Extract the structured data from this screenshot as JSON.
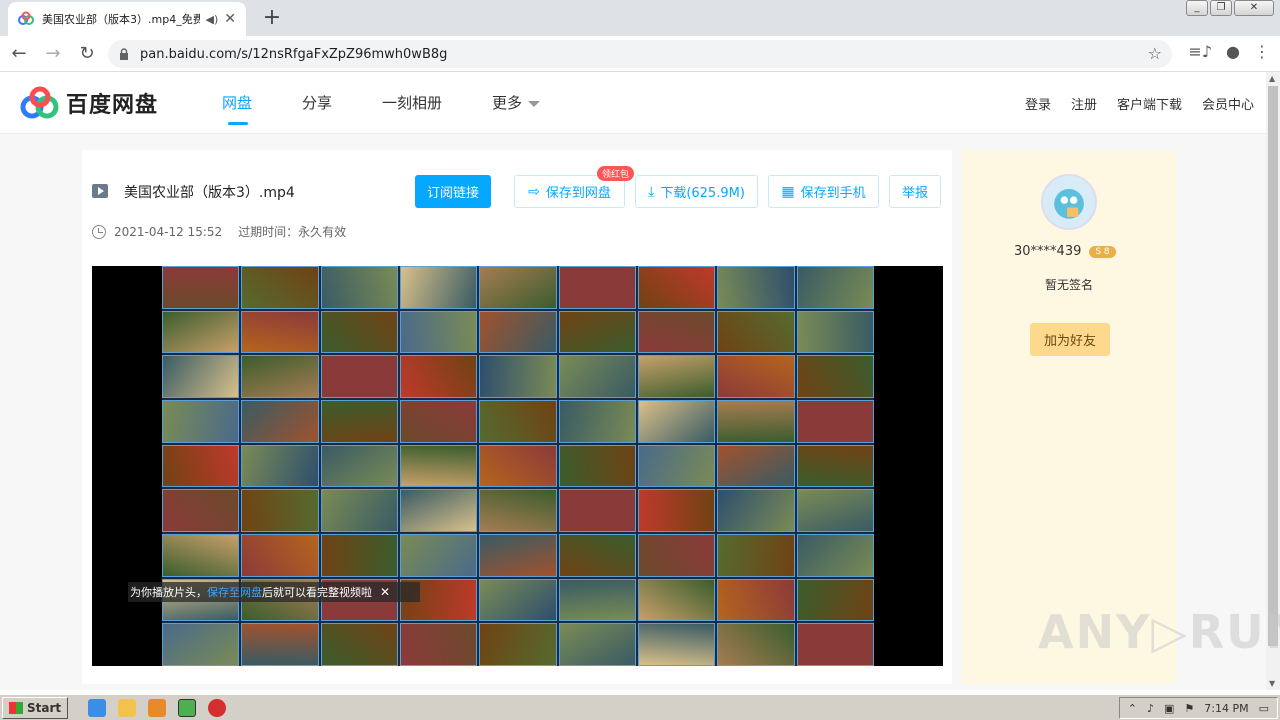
{
  "browser": {
    "tab_title": "美国农业部（版本3）.mp4_免费",
    "url": "pan.baidu.com/s/12nsRfgaFxZpZ96mwh0wB8g"
  },
  "site": {
    "brand": "百度网盘",
    "nav": [
      "网盘",
      "分享",
      "一刻相册",
      "更多"
    ],
    "toplinks": [
      "登录",
      "注册",
      "客户端下载",
      "会员中心"
    ]
  },
  "file": {
    "title": "美国农业部（版本3）.mp4",
    "date": "2021-04-12 15:52",
    "expiry": "过期时间：永久有效",
    "buttons": {
      "subscribe": "订阅链接",
      "save": "保存到网盘",
      "save_badge": "领红包",
      "download": "下载(625.9M)",
      "save_phone": "保存到手机",
      "report": "举报"
    },
    "notice": {
      "prefix": "为你播放片头，",
      "link": "保存至网盘",
      "suffix": "后就可以看完整视频啦"
    }
  },
  "sidebar": {
    "username": "30****439",
    "vip": "S 8",
    "signature": "暂无签名",
    "add_friend": "加为好友"
  },
  "watermark": "ANY▷RUN",
  "taskbar": {
    "start": "Start",
    "clock": "7:14 PM"
  }
}
